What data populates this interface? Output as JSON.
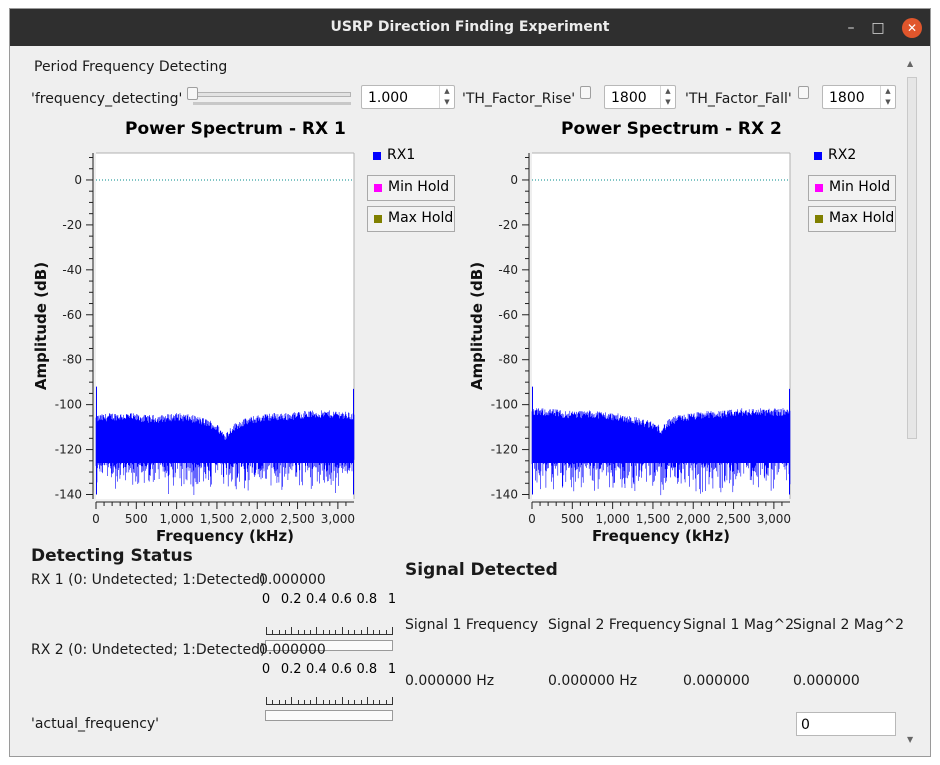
{
  "window": {
    "title": "USRP Direction Finding Experiment",
    "min_icon": "minimize-icon",
    "max_icon": "maximize-icon",
    "close_icon": "close-icon"
  },
  "section_title": "Period Frequency Detecting",
  "controls": {
    "freq_label": "'frequency_detecting'",
    "freq_value": "1.000",
    "rise_label": "'TH_Factor_Rise'",
    "rise_value": "1800",
    "fall_label": "'TH_Factor_Fall'",
    "fall_value": "1800"
  },
  "plots": [
    {
      "title": "Power Spectrum - RX 1",
      "xlabel": "Frequency (kHz)",
      "ylabel": "Amplitude (dB)",
      "legend": [
        {
          "label": "RX1",
          "color": "#0000ff"
        },
        {
          "label": "Min Hold",
          "color": "#ff00ff"
        },
        {
          "label": "Max Hold",
          "color": "#808000"
        }
      ]
    },
    {
      "title": "Power Spectrum - RX 2",
      "xlabel": "Frequency (kHz)",
      "ylabel": "Amplitude (dB)",
      "legend": [
        {
          "label": "RX2",
          "color": "#0000ff"
        },
        {
          "label": "Min Hold",
          "color": "#ff00ff"
        },
        {
          "label": "Max Hold",
          "color": "#808000"
        }
      ]
    }
  ],
  "chart_data": [
    {
      "type": "line",
      "title": "Power Spectrum - RX 1",
      "xlabel": "Frequency (kHz)",
      "ylabel": "Amplitude (dB)",
      "xlim": [
        0,
        3200
      ],
      "ylim": [
        -142,
        12
      ],
      "x_ticks": [
        0,
        500,
        1000,
        1500,
        2000,
        2500,
        3000
      ],
      "x_tick_labels": [
        "0",
        "500",
        "1,000",
        "1,500",
        "2,000",
        "2,500",
        "3,000"
      ],
      "y_ticks": [
        0,
        -20,
        -40,
        -60,
        -80,
        -100,
        -120,
        -140
      ],
      "y_tick_labels": [
        "0",
        "-20",
        "-40",
        "-60",
        "-80",
        "-100",
        "-120",
        "-140"
      ],
      "series": [
        {
          "name": "RX1",
          "color": "#0000ff",
          "x": [
            0,
            200,
            400,
            600,
            800,
            1000,
            1200,
            1400,
            1500,
            1600,
            1700,
            1800,
            2000,
            2200,
            2400,
            2600,
            2800,
            3000,
            3200
          ],
          "upper": [
            -107,
            -106,
            -106,
            -107,
            -107,
            -106,
            -107,
            -109,
            -111,
            -115,
            -111,
            -109,
            -107,
            -106,
            -106,
            -105,
            -105,
            -105,
            -106
          ],
          "lower": [
            -141,
            -141,
            -141,
            -141,
            -141,
            -141,
            -141,
            -141,
            -141,
            -141,
            -141,
            -141,
            -141,
            -141,
            -141,
            -141,
            -141,
            -141,
            -141
          ]
        },
        {
          "name": "Min Hold",
          "color": "#ff00ff",
          "x": [],
          "y": []
        },
        {
          "name": "Max Hold",
          "color": "#808000",
          "x": [],
          "y": []
        }
      ],
      "reference_line": {
        "y": 0,
        "color": "#008b8b",
        "style": "dotted"
      }
    },
    {
      "type": "line",
      "title": "Power Spectrum - RX 2",
      "xlabel": "Frequency (kHz)",
      "ylabel": "Amplitude (dB)",
      "xlim": [
        0,
        3200
      ],
      "ylim": [
        -142,
        12
      ],
      "x_ticks": [
        0,
        500,
        1000,
        1500,
        2000,
        2500,
        3000
      ],
      "x_tick_labels": [
        "0",
        "500",
        "1,000",
        "1,500",
        "2,000",
        "2,500",
        "3,000"
      ],
      "y_ticks": [
        0,
        -20,
        -40,
        -60,
        -80,
        -100,
        -120,
        -140
      ],
      "y_tick_labels": [
        "0",
        "-20",
        "-40",
        "-60",
        "-80",
        "-100",
        "-120",
        "-140"
      ],
      "series": [
        {
          "name": "RX2",
          "color": "#0000ff",
          "x": [
            0,
            200,
            400,
            600,
            800,
            1000,
            1200,
            1400,
            1500,
            1600,
            1700,
            1800,
            2000,
            2200,
            2400,
            2600,
            2800,
            3000,
            3200
          ],
          "upper": [
            -104,
            -104,
            -105,
            -105,
            -105,
            -106,
            -107,
            -109,
            -110,
            -112,
            -109,
            -107,
            -106,
            -105,
            -105,
            -104,
            -104,
            -104,
            -104
          ],
          "lower": [
            -141,
            -141,
            -141,
            -141,
            -141,
            -141,
            -141,
            -141,
            -141,
            -141,
            -141,
            -141,
            -141,
            -141,
            -141,
            -141,
            -141,
            -141,
            -141
          ]
        },
        {
          "name": "Min Hold",
          "color": "#ff00ff",
          "x": [],
          "y": []
        },
        {
          "name": "Max Hold",
          "color": "#808000",
          "x": [],
          "y": []
        }
      ],
      "reference_line": {
        "y": 0,
        "color": "#008b8b",
        "style": "dotted"
      }
    }
  ],
  "detecting": {
    "title": "Detecting Status",
    "rx1_label": "RX 1 (0: Undetected; 1:Detected)",
    "rx1_value": "0.000000",
    "rx1_level": 0,
    "rx2_label": "RX 2 (0: Undetected; 1:Detected)",
    "rx2_value": "0.000000",
    "rx2_level": 0,
    "scale_ticks": [
      "0",
      "0.2",
      "0.4",
      "0.6",
      "0.8",
      "1"
    ]
  },
  "signal": {
    "title": "Signal Detected",
    "headers": [
      "Signal 1 Frequency",
      "Signal 2 Frequency",
      "Signal 1 Mag^2",
      "Signal 2 Mag^2"
    ],
    "values": [
      "0.000000 Hz",
      "0.000000 Hz",
      "0.000000",
      "0.000000"
    ]
  },
  "actual": {
    "label": "'actual_frequency'",
    "value": "0"
  }
}
